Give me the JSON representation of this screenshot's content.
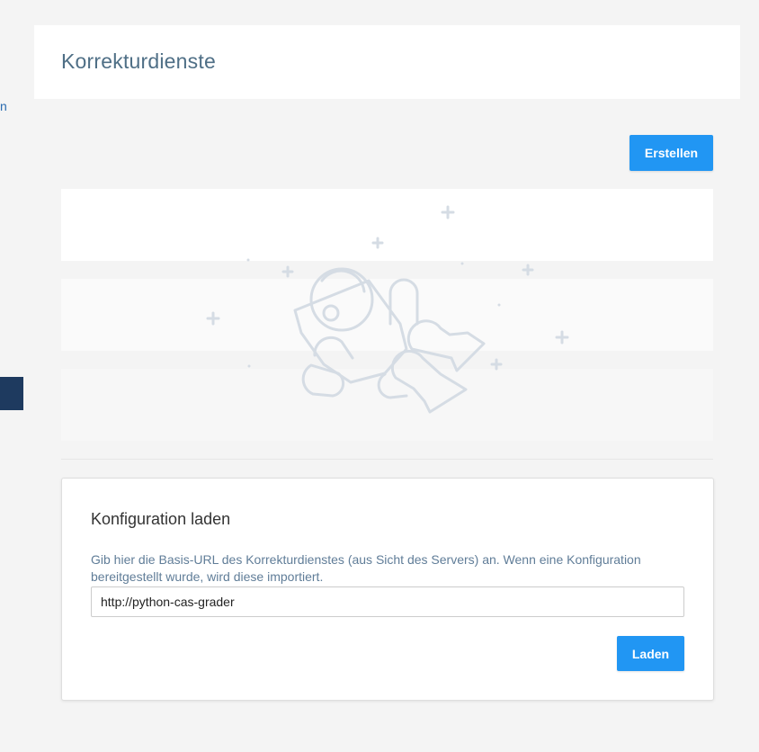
{
  "sidebar": {
    "partial_text": "n"
  },
  "header": {
    "title": "Korrekturdienste"
  },
  "actions": {
    "create_label": "Erstellen"
  },
  "colors": {
    "primary": "#2196f3",
    "title": "#4f6f86",
    "sidebar_active": "#1e3a5f",
    "illustration": "#d5dce4"
  },
  "empty_state": {
    "icon": "astronaut-icon"
  },
  "config_card": {
    "title": "Konfiguration laden",
    "description": "Gib hier die Basis-URL des Korrekturdienstes (aus Sicht des Servers) an. Wenn eine Konfiguration bereitgestellt wurde, wird diese importiert.",
    "url_value": "http://python-cas-grader",
    "load_label": "Laden"
  }
}
